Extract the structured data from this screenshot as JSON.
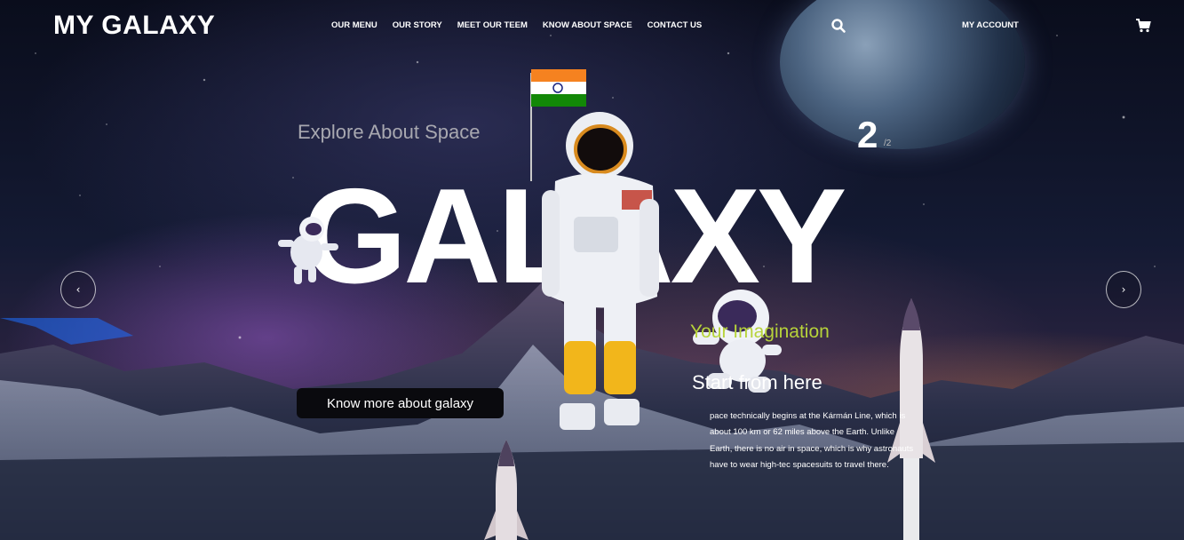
{
  "brand": {
    "logo": "MY GALAXY"
  },
  "nav": {
    "items": [
      "OUR MENU",
      "OUR STORY",
      "MEET OUR TEEM",
      "KNOW ABOUT SPACE",
      "CONTACT US"
    ],
    "account": "MY ACCOUNT",
    "search_icon": "search-icon",
    "cart_icon": "cart-icon"
  },
  "hero": {
    "kicker": "Explore About Space",
    "title": "GALAXY",
    "slide_current": "2",
    "slide_total": "/2",
    "cta": "Know more about galaxy",
    "prev_icon": "chevron-left-icon",
    "next_icon": "chevron-right-icon"
  },
  "info": {
    "tagline": "Your Imagination",
    "subhead": "Start from here",
    "body": "pace technically begins at the Kármán Line, which is about 100 km or 62 miles above the Earth. Unlike Earth, there is no air in space, which is why astronauts have to wear high-tec spacesuits to travel there."
  },
  "colors": {
    "accent_green": "#b7d33a",
    "cta_bg": "#0a0a0e"
  }
}
